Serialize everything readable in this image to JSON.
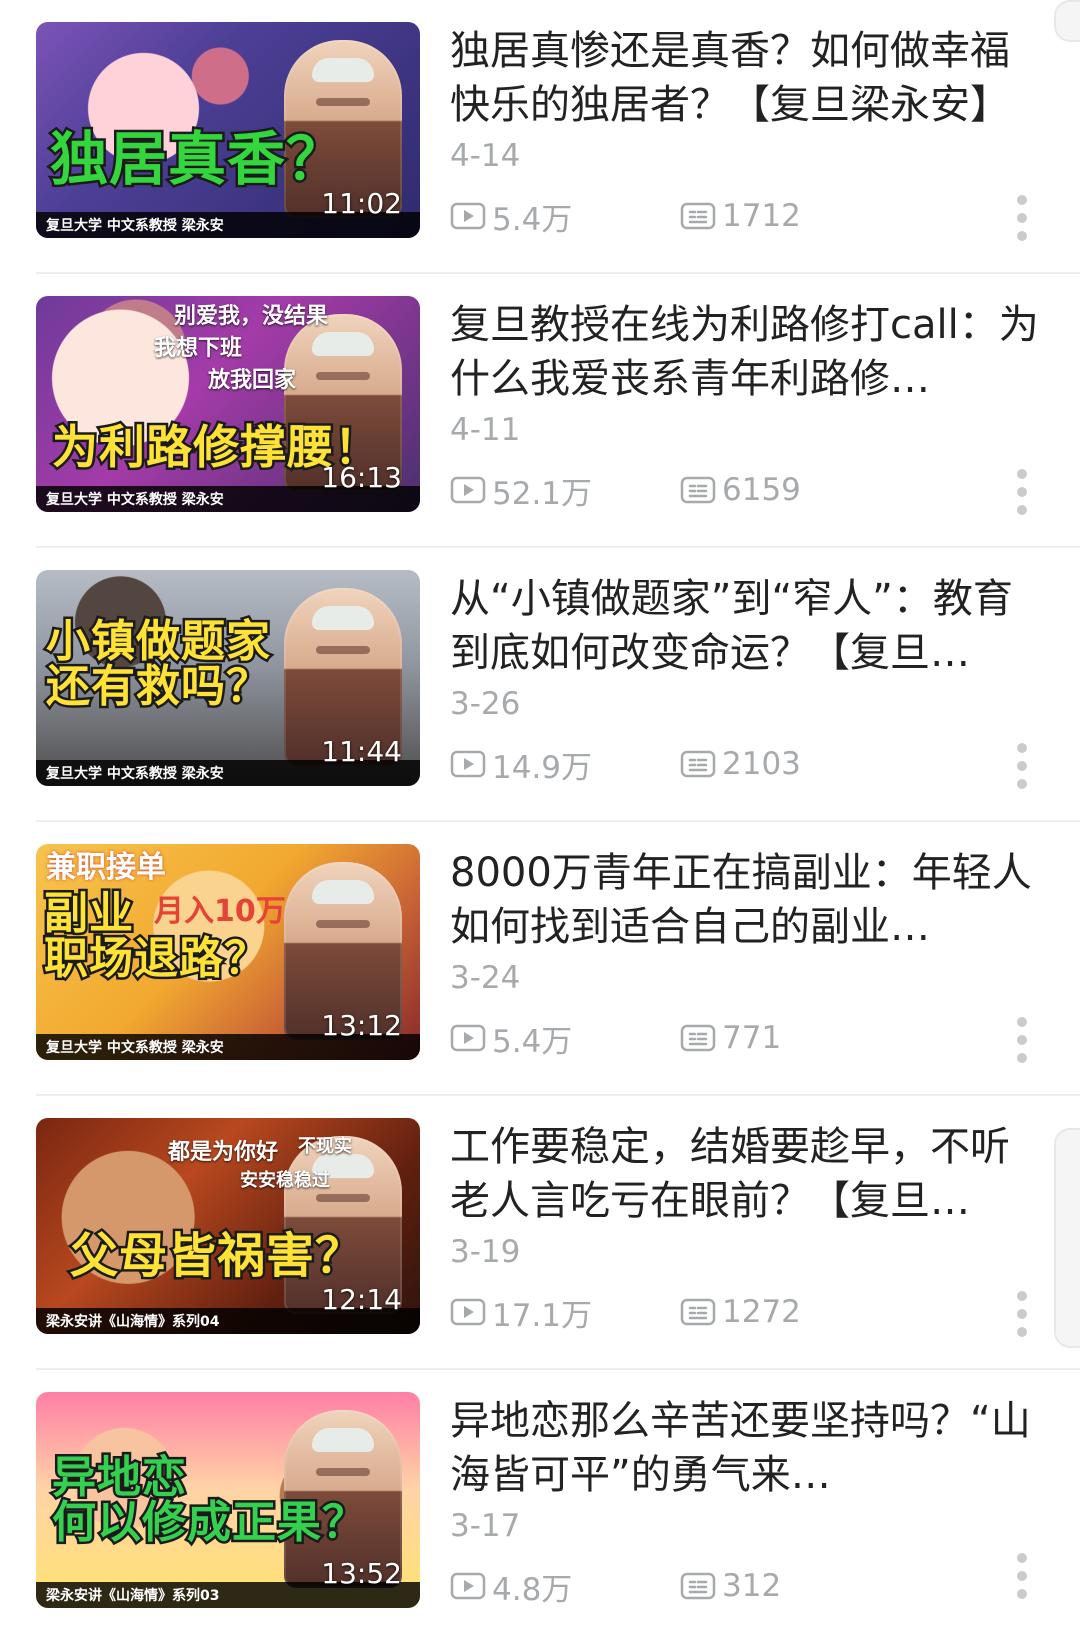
{
  "list": {
    "items": [
      {
        "thumbnail": {
          "headline_lines": [
            "独居真香？"
          ],
          "caption": "复旦大学 中文系教授 梁永安",
          "duration": "11:02",
          "headline_color": "#34d63d",
          "headline_size_class": "large"
        },
        "title": "独居真惨还是真香？如何做幸福快乐的独居者？【复旦梁永安】",
        "date": "4-14",
        "views": "5.4万",
        "danmaku": "1712"
      },
      {
        "thumbnail": {
          "headline_lines": [
            "为利路修撑腰！"
          ],
          "overlay_text": [
            "别爱我，没结果",
            "我想下班",
            "放我回家"
          ],
          "caption": "复旦大学 中文系教授 梁永安",
          "duration": "16:13",
          "headline_color": "#ffe236",
          "headline_size_class": "medium"
        },
        "title": "复旦教授在线为利路修打call：为什么我爱丧系青年利路修…",
        "date": "4-11",
        "views": "52.1万",
        "danmaku": "6159"
      },
      {
        "thumbnail": {
          "headline_lines": [
            "小镇做题家",
            "还有救吗？"
          ],
          "caption": "复旦大学 中文系教授 梁永安",
          "duration": "11:44",
          "headline_color": "#ffe236",
          "headline_size_class": "medium"
        },
        "title": "从“小镇做题家”到“窄人”：教育到底如何改变命运？【复旦…",
        "date": "3-26",
        "views": "14.9万",
        "danmaku": "2103"
      },
      {
        "thumbnail": {
          "headline_lines": [
            "副业",
            "职场退路？"
          ],
          "overlay_text": [
            "兼职接单",
            "月入10万"
          ],
          "caption": "复旦大学 中文系教授 梁永安",
          "duration": "13:12",
          "headline_color": "#ffe236",
          "headline_size_class": "medium"
        },
        "title": "8000万青年正在搞副业：年轻人如何找到适合自己的副业…",
        "date": "3-24",
        "views": "5.4万",
        "danmaku": "771"
      },
      {
        "thumbnail": {
          "headline_lines": [
            "父母皆祸害？"
          ],
          "overlay_text": [
            "都是为你好",
            "不现实",
            "安安稳稳过"
          ],
          "caption": "梁永安讲《山海情》系列04",
          "duration": "12:14",
          "headline_color": "#ffe236",
          "headline_size_class": "medium"
        },
        "title": "工作要稳定，结婚要趁早，不听老人言吃亏在眼前？【复旦…",
        "date": "3-19",
        "views": "17.1万",
        "danmaku": "1272"
      },
      {
        "thumbnail": {
          "headline_lines": [
            "异地恋",
            "何以修成正果？"
          ],
          "caption": "梁永安讲《山海情》系列03",
          "duration": "13:52",
          "headline_color": "#35d04f",
          "headline_size_class": "medium"
        },
        "title": "异地恋那么辛苦还要坚持吗？“山海皆可平”的勇气来…",
        "date": "3-17",
        "views": "4.8万",
        "danmaku": "312"
      }
    ]
  },
  "icons": {
    "play": "play-count-icon",
    "danmaku": "danmaku-count-icon",
    "more": "more-icon"
  },
  "colors": {
    "text_primary": "#222222",
    "text_secondary": "#a6aaad",
    "divider": "#eceef2",
    "accent_green": "#34d63d",
    "accent_yellow": "#ffe236",
    "accent_red": "#e44335"
  }
}
